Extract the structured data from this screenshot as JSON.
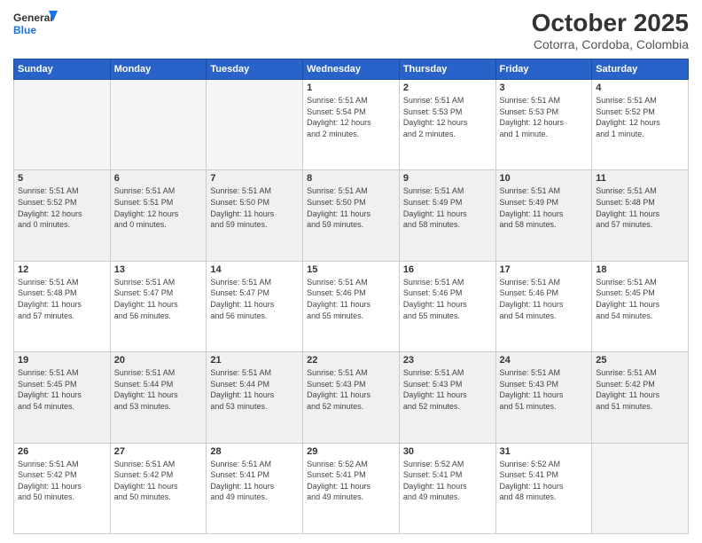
{
  "header": {
    "logo_line1": "General",
    "logo_line2": "Blue",
    "month": "October 2025",
    "location": "Cotorra, Cordoba, Colombia"
  },
  "weekdays": [
    "Sunday",
    "Monday",
    "Tuesday",
    "Wednesday",
    "Thursday",
    "Friday",
    "Saturday"
  ],
  "weeks": [
    {
      "shaded": false,
      "days": [
        {
          "num": "",
          "info": ""
        },
        {
          "num": "",
          "info": ""
        },
        {
          "num": "",
          "info": ""
        },
        {
          "num": "1",
          "info": "Sunrise: 5:51 AM\nSunset: 5:54 PM\nDaylight: 12 hours\nand 2 minutes."
        },
        {
          "num": "2",
          "info": "Sunrise: 5:51 AM\nSunset: 5:53 PM\nDaylight: 12 hours\nand 2 minutes."
        },
        {
          "num": "3",
          "info": "Sunrise: 5:51 AM\nSunset: 5:53 PM\nDaylight: 12 hours\nand 1 minute."
        },
        {
          "num": "4",
          "info": "Sunrise: 5:51 AM\nSunset: 5:52 PM\nDaylight: 12 hours\nand 1 minute."
        }
      ]
    },
    {
      "shaded": true,
      "days": [
        {
          "num": "5",
          "info": "Sunrise: 5:51 AM\nSunset: 5:52 PM\nDaylight: 12 hours\nand 0 minutes."
        },
        {
          "num": "6",
          "info": "Sunrise: 5:51 AM\nSunset: 5:51 PM\nDaylight: 12 hours\nand 0 minutes."
        },
        {
          "num": "7",
          "info": "Sunrise: 5:51 AM\nSunset: 5:50 PM\nDaylight: 11 hours\nand 59 minutes."
        },
        {
          "num": "8",
          "info": "Sunrise: 5:51 AM\nSunset: 5:50 PM\nDaylight: 11 hours\nand 59 minutes."
        },
        {
          "num": "9",
          "info": "Sunrise: 5:51 AM\nSunset: 5:49 PM\nDaylight: 11 hours\nand 58 minutes."
        },
        {
          "num": "10",
          "info": "Sunrise: 5:51 AM\nSunset: 5:49 PM\nDaylight: 11 hours\nand 58 minutes."
        },
        {
          "num": "11",
          "info": "Sunrise: 5:51 AM\nSunset: 5:48 PM\nDaylight: 11 hours\nand 57 minutes."
        }
      ]
    },
    {
      "shaded": false,
      "days": [
        {
          "num": "12",
          "info": "Sunrise: 5:51 AM\nSunset: 5:48 PM\nDaylight: 11 hours\nand 57 minutes."
        },
        {
          "num": "13",
          "info": "Sunrise: 5:51 AM\nSunset: 5:47 PM\nDaylight: 11 hours\nand 56 minutes."
        },
        {
          "num": "14",
          "info": "Sunrise: 5:51 AM\nSunset: 5:47 PM\nDaylight: 11 hours\nand 56 minutes."
        },
        {
          "num": "15",
          "info": "Sunrise: 5:51 AM\nSunset: 5:46 PM\nDaylight: 11 hours\nand 55 minutes."
        },
        {
          "num": "16",
          "info": "Sunrise: 5:51 AM\nSunset: 5:46 PM\nDaylight: 11 hours\nand 55 minutes."
        },
        {
          "num": "17",
          "info": "Sunrise: 5:51 AM\nSunset: 5:46 PM\nDaylight: 11 hours\nand 54 minutes."
        },
        {
          "num": "18",
          "info": "Sunrise: 5:51 AM\nSunset: 5:45 PM\nDaylight: 11 hours\nand 54 minutes."
        }
      ]
    },
    {
      "shaded": true,
      "days": [
        {
          "num": "19",
          "info": "Sunrise: 5:51 AM\nSunset: 5:45 PM\nDaylight: 11 hours\nand 54 minutes."
        },
        {
          "num": "20",
          "info": "Sunrise: 5:51 AM\nSunset: 5:44 PM\nDaylight: 11 hours\nand 53 minutes."
        },
        {
          "num": "21",
          "info": "Sunrise: 5:51 AM\nSunset: 5:44 PM\nDaylight: 11 hours\nand 53 minutes."
        },
        {
          "num": "22",
          "info": "Sunrise: 5:51 AM\nSunset: 5:43 PM\nDaylight: 11 hours\nand 52 minutes."
        },
        {
          "num": "23",
          "info": "Sunrise: 5:51 AM\nSunset: 5:43 PM\nDaylight: 11 hours\nand 52 minutes."
        },
        {
          "num": "24",
          "info": "Sunrise: 5:51 AM\nSunset: 5:43 PM\nDaylight: 11 hours\nand 51 minutes."
        },
        {
          "num": "25",
          "info": "Sunrise: 5:51 AM\nSunset: 5:42 PM\nDaylight: 11 hours\nand 51 minutes."
        }
      ]
    },
    {
      "shaded": false,
      "days": [
        {
          "num": "26",
          "info": "Sunrise: 5:51 AM\nSunset: 5:42 PM\nDaylight: 11 hours\nand 50 minutes."
        },
        {
          "num": "27",
          "info": "Sunrise: 5:51 AM\nSunset: 5:42 PM\nDaylight: 11 hours\nand 50 minutes."
        },
        {
          "num": "28",
          "info": "Sunrise: 5:51 AM\nSunset: 5:41 PM\nDaylight: 11 hours\nand 49 minutes."
        },
        {
          "num": "29",
          "info": "Sunrise: 5:52 AM\nSunset: 5:41 PM\nDaylight: 11 hours\nand 49 minutes."
        },
        {
          "num": "30",
          "info": "Sunrise: 5:52 AM\nSunset: 5:41 PM\nDaylight: 11 hours\nand 49 minutes."
        },
        {
          "num": "31",
          "info": "Sunrise: 5:52 AM\nSunset: 5:41 PM\nDaylight: 11 hours\nand 48 minutes."
        },
        {
          "num": "",
          "info": ""
        }
      ]
    }
  ]
}
